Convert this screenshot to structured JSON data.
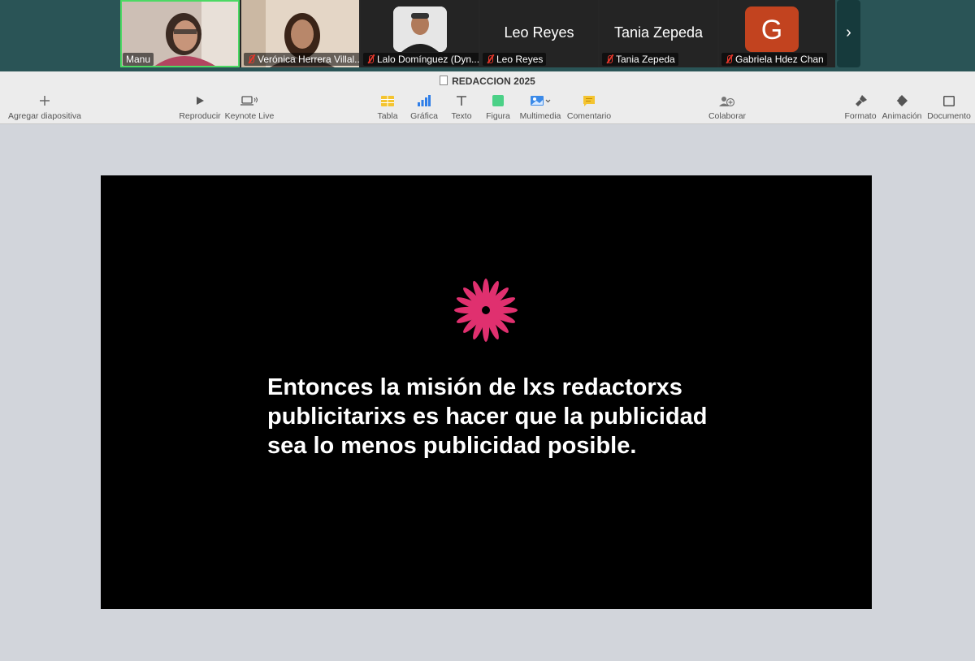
{
  "meeting": {
    "participants": [
      {
        "name": "Manu",
        "muted": false,
        "active": true
      },
      {
        "name": "Verónica Herrera Villal...",
        "muted": true
      },
      {
        "name": "Lalo Domínguez (Dyn...",
        "muted": true
      },
      {
        "name": "Leo Reyes",
        "display": "Leo Reyes",
        "muted": true
      },
      {
        "name": "Tania Zepeda",
        "display": "Tania Zepeda",
        "muted": true
      },
      {
        "name": "Gabriela Hdez Chan",
        "initial": "G",
        "avatar_color": "#c2431f",
        "muted": true
      }
    ],
    "next_icon": "›"
  },
  "keynote": {
    "title": "REDACCION 2025",
    "toolbar": {
      "add_slide": "Agregar diapositiva",
      "play": "Reproducir",
      "keynote_live": "Keynote Live",
      "table": "Tabla",
      "chart": "Gráfica",
      "text": "Texto",
      "shape": "Figura",
      "media": "Multimedia",
      "comment": "Comentario",
      "collaborate": "Colaborar",
      "format": "Formato",
      "animate": "Animación",
      "document": "Documento"
    },
    "slide": {
      "text": "Entonces la misión de lxs redactorxs\npublicitarixs es hacer que la publicidad\nsea lo menos publicidad posible.",
      "flower_color": "#e0306f",
      "background": "#000000"
    }
  }
}
